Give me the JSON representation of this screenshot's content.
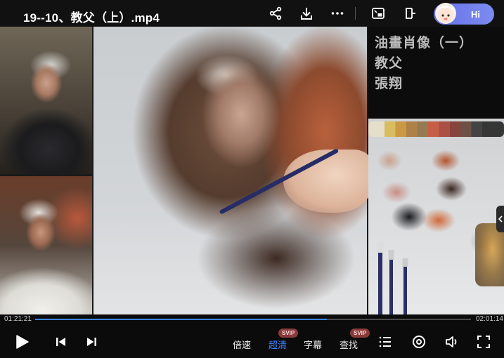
{
  "header": {
    "title": "19--10、教父（上）.mp4",
    "assistant_label": "Hi"
  },
  "video": {
    "caption_lines": [
      "油畫肖像（一）",
      "教父",
      "張翔"
    ]
  },
  "progress": {
    "current_time": "01:21:21",
    "total_time": "02:01:14",
    "played_fraction": 0.67,
    "accent_color": "#3a86ff"
  },
  "controls": {
    "speed_label": "倍速",
    "quality_label": "超清",
    "quality_badge": "SVIP",
    "subtitle_label": "字幕",
    "search_label": "查找",
    "search_badge": "SVIP"
  },
  "icons": {
    "share": "share-icon",
    "download": "download-icon",
    "more": "more-icon",
    "pip": "picture-in-picture-icon",
    "float": "float-window-icon",
    "play": "play-icon",
    "previous": "skip-previous-icon",
    "next": "skip-next-icon",
    "playlist": "playlist-icon",
    "settings": "settings-icon",
    "volume": "volume-icon",
    "fullscreen": "fullscreen-icon"
  }
}
